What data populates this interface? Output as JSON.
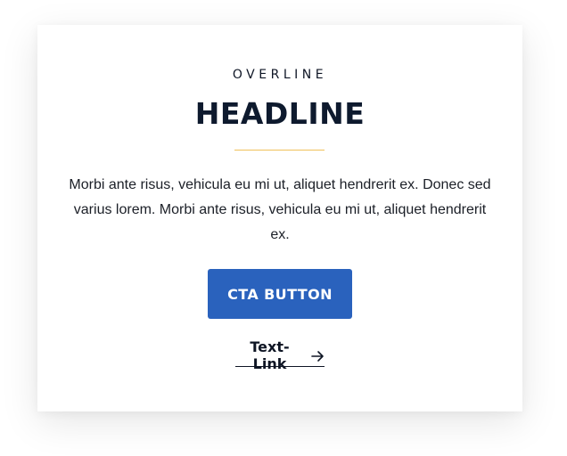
{
  "card": {
    "overline": "OVERLINE",
    "headline": "HEADLINE",
    "body": "Morbi ante risus, vehicula eu mi ut, aliquet hendrerit ex. Donec sed varius lorem. Morbi ante risus, vehicula eu mi ut, aliquet hendrerit ex.",
    "cta_label": "CTA BUTTON",
    "link_label": "Text-Link",
    "link_icon": "arrow-right-icon"
  },
  "colors": {
    "accent": "#2a62bd",
    "divider": "#f0c15a",
    "text_dark": "#0e1a2e"
  }
}
